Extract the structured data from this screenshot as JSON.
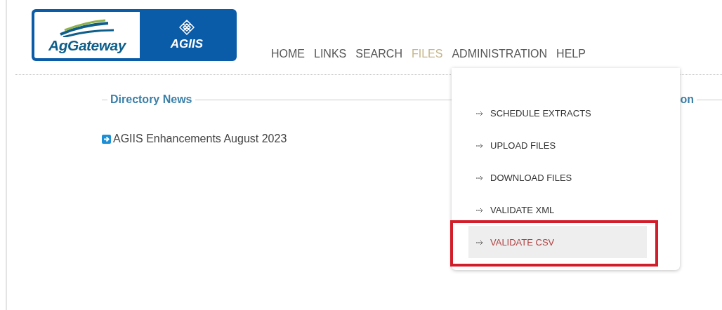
{
  "logo": {
    "left_text": "AgGateway",
    "right_text": "AGIIS"
  },
  "nav": [
    {
      "label": "HOME",
      "selected": false
    },
    {
      "label": "LINKS",
      "selected": false
    },
    {
      "label": "SEARCH",
      "selected": false
    },
    {
      "label": "FILES",
      "selected": true
    },
    {
      "label": "ADMINISTRATION",
      "selected": false
    },
    {
      "label": "HELP",
      "selected": false
    }
  ],
  "directory_news": {
    "title": "Directory News",
    "items": [
      "AGIIS Enhancements August 2023"
    ]
  },
  "right_section": {
    "title": "on"
  },
  "files_menu": [
    {
      "label": "SCHEDULE EXTRACTS",
      "selected": false,
      "highlighted": false
    },
    {
      "label": "UPLOAD FILES",
      "selected": false,
      "highlighted": false
    },
    {
      "label": "DOWNLOAD FILES",
      "selected": false,
      "highlighted": false
    },
    {
      "label": "VALIDATE XML",
      "selected": false,
      "highlighted": false
    },
    {
      "label": "VALIDATE CSV",
      "selected": true,
      "highlighted": true
    }
  ]
}
